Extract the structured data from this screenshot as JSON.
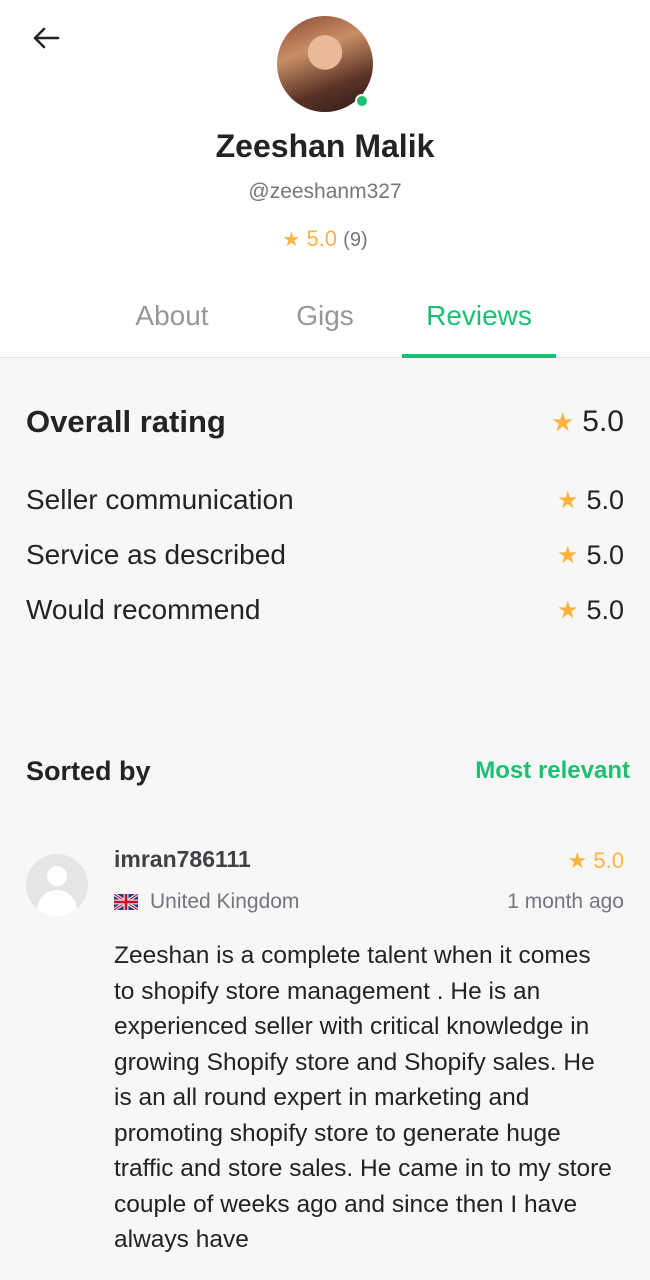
{
  "profile": {
    "name": "Zeeshan Malik",
    "handle": "@zeeshanm327",
    "rating": "5.0",
    "rating_count": "(9)",
    "online": true
  },
  "tabs": [
    {
      "label": "About",
      "active": false
    },
    {
      "label": "Gigs",
      "active": false
    },
    {
      "label": "Reviews",
      "active": true
    }
  ],
  "ratings": {
    "overall": {
      "label": "Overall rating",
      "value": "5.0"
    },
    "items": [
      {
        "label": "Seller communication",
        "value": "5.0"
      },
      {
        "label": "Service as described",
        "value": "5.0"
      },
      {
        "label": "Would recommend",
        "value": "5.0"
      }
    ]
  },
  "sort": {
    "label": "Sorted by",
    "value": "Most relevant"
  },
  "review": {
    "username": "imran786111",
    "score": "5.0",
    "country": "United Kingdom",
    "time": "1 month ago",
    "text": "Zeeshan is a complete talent when it comes to shopify store management . He is an experienced seller with critical knowledge in growing Shopify store and Shopify sales. He is an all round expert in marketing and promoting shopify store to generate huge traffic and store sales. He came in to my store couple of weeks ago and since then I have always have"
  },
  "colors": {
    "accent": "#1dbf73",
    "star": "#ffb33e",
    "muted": "#74767e",
    "background": "#f7f7f7"
  },
  "icons": {
    "back": "arrow-left-icon",
    "star": "star-icon",
    "flag": "uk-flag-icon",
    "avatar_placeholder": "user-placeholder-icon"
  }
}
